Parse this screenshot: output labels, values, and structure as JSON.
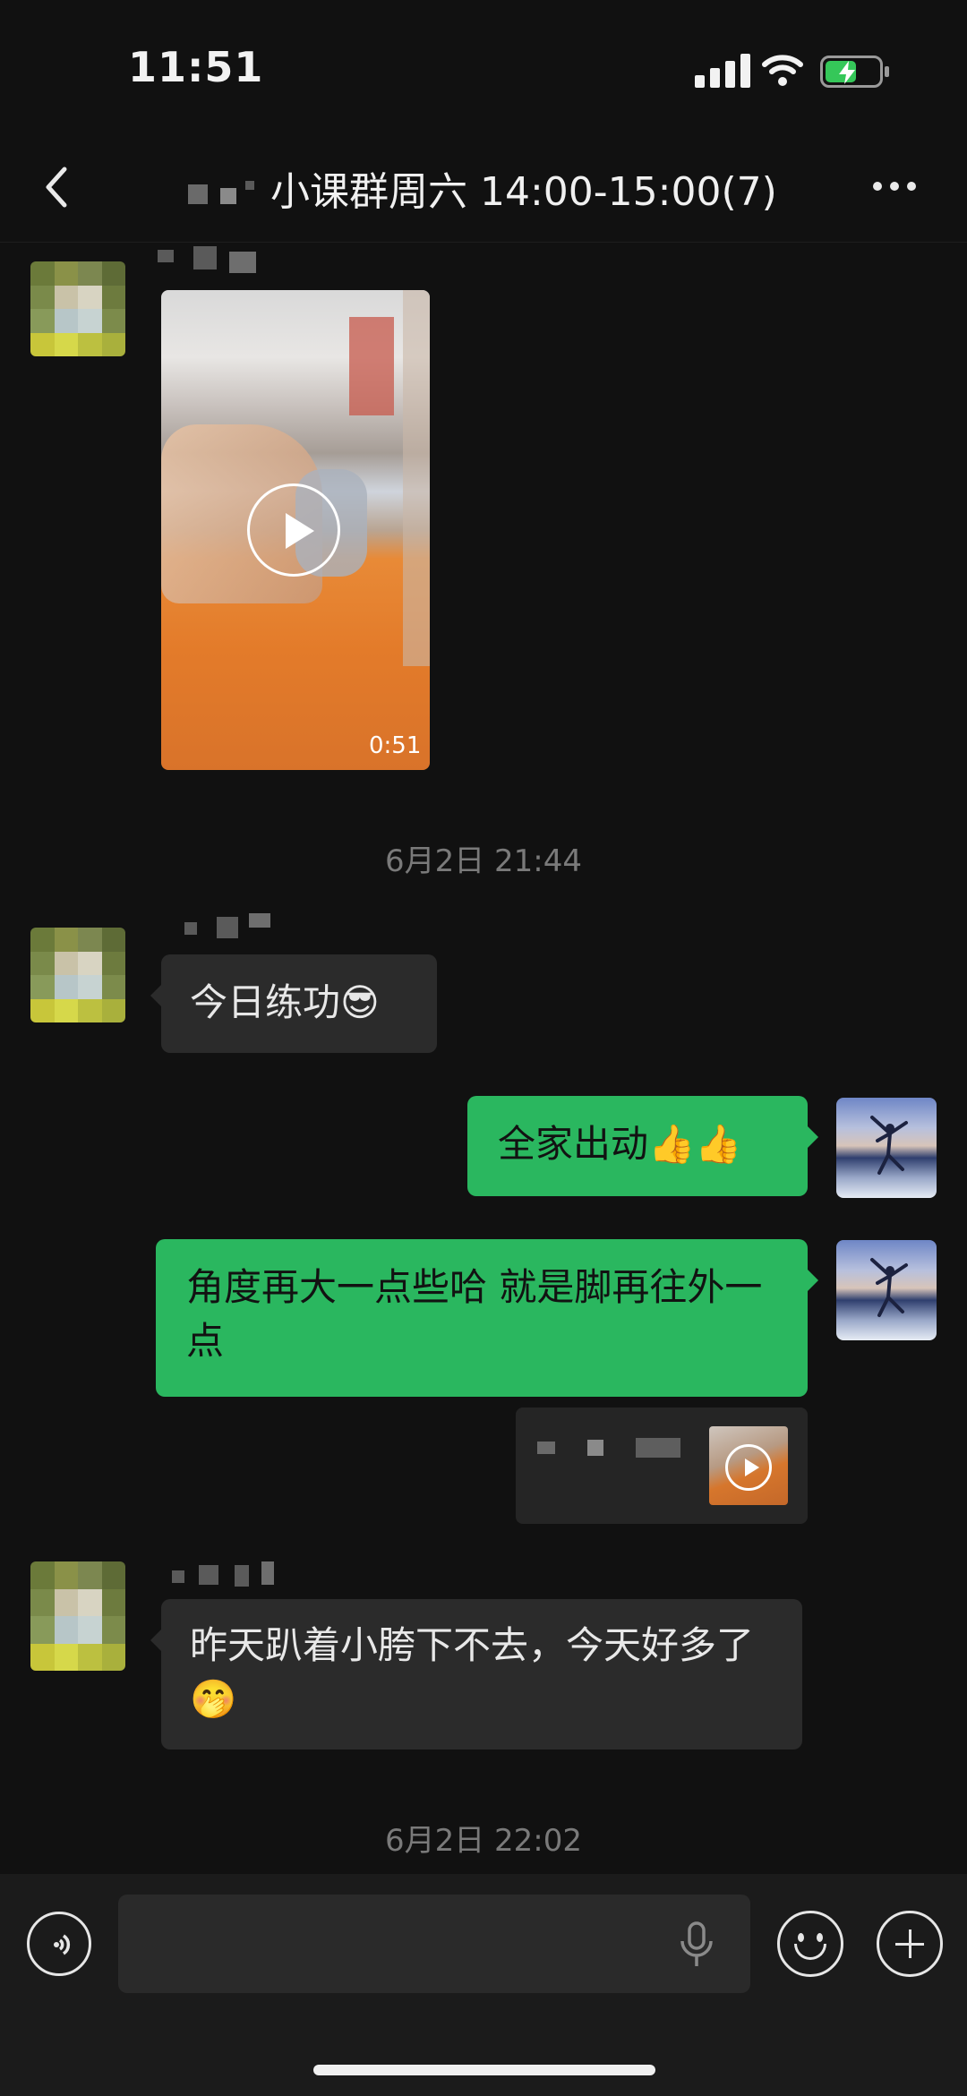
{
  "status_bar": {
    "time": "11:51"
  },
  "header": {
    "title": "小课群周六 14:00-15:00(7)"
  },
  "messages": {
    "video": {
      "duration": "0:51"
    },
    "timestamp_1": "6月2日 21:44",
    "msg_in_1": "今日练功😎",
    "msg_out_1": "全家出动👍👍",
    "msg_out_2": "角度再大一点些哈 就是脚再往外一点",
    "msg_in_2": "昨天趴着小胯下不去，今天好多了🤭",
    "timestamp_2": "6月2日 22:02"
  },
  "icons": {
    "back": "chevron-left-icon",
    "more": "more-dots-icon",
    "voice": "voice-icon",
    "mic": "microphone-icon",
    "emoji": "emoji-icon",
    "add": "plus-icon",
    "play": "play-icon"
  },
  "colors": {
    "background": "#111111",
    "incoming_bubble": "#2b2b2b",
    "outgoing_bubble": "#2ab75f"
  }
}
